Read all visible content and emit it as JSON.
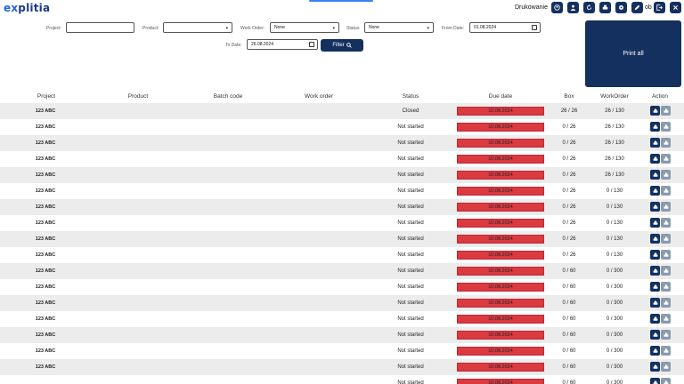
{
  "header": {
    "logo": "explitia",
    "username": "Drukowanie",
    "ob_label": "ob",
    "icons": [
      "user-circle-icon",
      "person-icon",
      "refresh-icon",
      "print-icon",
      "settings-icon",
      "edit-icon",
      "logout-icon",
      "close-icon"
    ]
  },
  "filters": {
    "project_label": "Project:",
    "project_value": "",
    "product_label": "Product:",
    "product_value": "",
    "work_order_label": "Work Order:",
    "work_order_value": "None",
    "status_label": "Status:",
    "status_value": "None",
    "from_date_label": "From Date:",
    "from_date_value": "01.08.2024",
    "to_date_label": "To Date:",
    "to_date_value": "26.08.2024",
    "filter_button": "Filter",
    "print_all_button": "Print all"
  },
  "table": {
    "columns": [
      "Project",
      "Product",
      "Batch code",
      "Work order",
      "Status",
      "Due date",
      "Box",
      "WorkOrder",
      "Action"
    ],
    "rows": [
      {
        "project": "123 ABC",
        "status": "Closed",
        "due": "10.08.2024",
        "box": "26 / 26",
        "workorder": "26 / 130"
      },
      {
        "project": "123 ABC",
        "status": "Not started",
        "due": "10.08.2024",
        "box": "0 / 26",
        "workorder": "26 / 130"
      },
      {
        "project": "123 ABC",
        "status": "Not started",
        "due": "10.08.2024",
        "box": "0 / 26",
        "workorder": "26 / 130"
      },
      {
        "project": "123 ABC",
        "status": "Not started",
        "due": "10.08.2024",
        "box": "0 / 26",
        "workorder": "26 / 130"
      },
      {
        "project": "123 ABC",
        "status": "Not started",
        "due": "10.08.2024",
        "box": "0 / 26",
        "workorder": "26 / 130"
      },
      {
        "project": "123 ABC",
        "status": "Not started",
        "due": "10.08.2024",
        "box": "0 / 26",
        "workorder": "0 / 130"
      },
      {
        "project": "123 ABC",
        "status": "Not started",
        "due": "10.08.2024",
        "box": "0 / 26",
        "workorder": "0 / 130"
      },
      {
        "project": "123 ABC",
        "status": "Not started",
        "due": "10.08.2024",
        "box": "0 / 26",
        "workorder": "0 / 130"
      },
      {
        "project": "123 ABC",
        "status": "Not started",
        "due": "10.08.2024",
        "box": "0 / 26",
        "workorder": "0 / 130"
      },
      {
        "project": "123 ABC",
        "status": "Not started",
        "due": "10.08.2024",
        "box": "0 / 26",
        "workorder": "0 / 130"
      },
      {
        "project": "123 ABC",
        "status": "Not started",
        "due": "10.08.2024",
        "box": "0 / 60",
        "workorder": "0 / 300"
      },
      {
        "project": "123 ABC",
        "status": "Not started",
        "due": "10.08.2024",
        "box": "0 / 60",
        "workorder": "0 / 300"
      },
      {
        "project": "123 ABC",
        "status": "Not started",
        "due": "10.08.2024",
        "box": "0 / 60",
        "workorder": "0 / 300"
      },
      {
        "project": "123 ABC",
        "status": "Not started",
        "due": "10.08.2024",
        "box": "0 / 60",
        "workorder": "0 / 300"
      },
      {
        "project": "123 ABC",
        "status": "Not started",
        "due": "10.08.2024",
        "box": "0 / 60",
        "workorder": "0 / 300"
      },
      {
        "project": "123 ABC",
        "status": "Not started",
        "due": "10.08.2024",
        "box": "0 / 60",
        "workorder": "0 / 300"
      },
      {
        "project": "123 ABC",
        "status": "Not started",
        "due": "10.08.2024",
        "box": "0 / 60",
        "workorder": "0 / 300"
      },
      {
        "project": "",
        "status": "Not started",
        "due": "10.08.2024",
        "box": "0 / 60",
        "workorder": "0 / 300"
      }
    ]
  },
  "colors": {
    "brand": "#14305f",
    "overdue": "#dc3940",
    "row_alt": "#ececec"
  }
}
